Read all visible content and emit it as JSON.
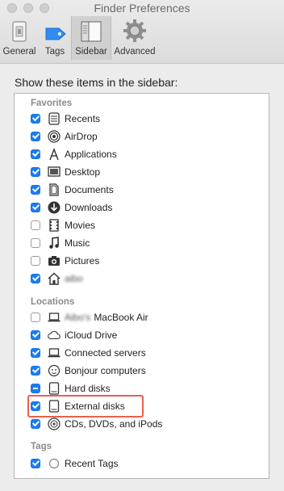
{
  "window": {
    "title": "Finder Preferences"
  },
  "toolbar": {
    "tabs": [
      {
        "label": "General",
        "icon": "general-icon",
        "active": false
      },
      {
        "label": "Tags",
        "icon": "tag-icon",
        "active": false
      },
      {
        "label": "Sidebar",
        "icon": "sidebar-icon",
        "active": true
      },
      {
        "label": "Advanced",
        "icon": "gear-icon",
        "active": false
      }
    ]
  },
  "sidebar_prefs": {
    "heading": "Show these items in the sidebar:",
    "favorites_title": "Favorites",
    "locations_title": "Locations",
    "tags_title": "Tags",
    "favorites": [
      {
        "label": "Recents",
        "checked": true,
        "icon": "recents-icon"
      },
      {
        "label": "AirDrop",
        "checked": true,
        "icon": "airdrop-icon"
      },
      {
        "label": "Applications",
        "checked": true,
        "icon": "applications-icon"
      },
      {
        "label": "Desktop",
        "checked": true,
        "icon": "desktop-icon"
      },
      {
        "label": "Documents",
        "checked": true,
        "icon": "documents-icon"
      },
      {
        "label": "Downloads",
        "checked": true,
        "icon": "downloads-icon"
      },
      {
        "label": "Movies",
        "checked": false,
        "icon": "movies-icon"
      },
      {
        "label": "Music",
        "checked": false,
        "icon": "music-icon"
      },
      {
        "label": "Pictures",
        "checked": false,
        "icon": "pictures-icon"
      },
      {
        "label": "aibo",
        "checked": true,
        "icon": "home-icon",
        "blurred": true
      }
    ],
    "locations": [
      {
        "label_blurred": "Aibo's",
        "label": "MacBook Air",
        "checked": false,
        "icon": "laptop-icon"
      },
      {
        "label": "iCloud Drive",
        "checked": true,
        "icon": "cloud-icon"
      },
      {
        "label": "Connected servers",
        "checked": true,
        "icon": "server-icon"
      },
      {
        "label": "Bonjour computers",
        "checked": true,
        "icon": "bonjour-icon"
      },
      {
        "label": "Hard disks",
        "checked": "mixed",
        "icon": "hard-disk-icon"
      },
      {
        "label": "External disks",
        "checked": true,
        "icon": "external-disk-icon",
        "highlighted": true
      },
      {
        "label": "CDs, DVDs, and iPods",
        "checked": true,
        "icon": "cd-icon"
      }
    ],
    "tags": [
      {
        "label": "Recent Tags",
        "checked": true,
        "icon": "tag-circle-icon"
      }
    ]
  },
  "colors": {
    "checkbox_blue": "#1a7cf5",
    "highlight_red": "#e8604c"
  }
}
